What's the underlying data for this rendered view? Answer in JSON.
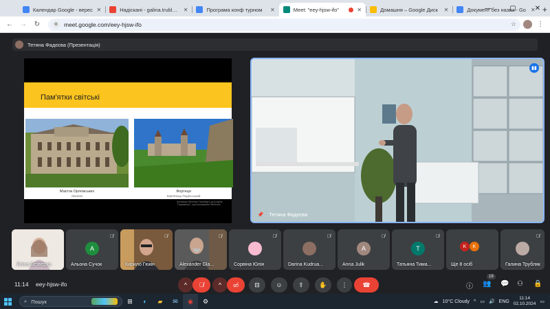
{
  "browser": {
    "tabs": [
      {
        "label": "Календар Google - верес",
        "color": "#4285f4",
        "active": false
      },
      {
        "label": "Надіскані - galina.trublaiev",
        "color": "#ea4335",
        "active": false
      },
      {
        "label": "Програма конф турном",
        "color": "#4285f4",
        "active": false
      },
      {
        "label": "Meet: \"eey-hjsw-ifo\"",
        "color": "#00897b",
        "active": true
      },
      {
        "label": "Домашня – Google Диск",
        "color": "#fbbc04",
        "active": false
      },
      {
        "label": "Документ без назви - Go",
        "color": "#4285f4",
        "active": false
      }
    ],
    "url": "meet.google.com/eey-hjsw-ifo",
    "new_tab": "+",
    "win_min": "—",
    "win_max": "▢",
    "win_close": "✕"
  },
  "meeting": {
    "presenter_header": "Тетяна Фадєєва (Презентація)",
    "slide": {
      "title": "Пам'ятки світські",
      "caption1": "Маєток Орловських",
      "caption1_sub": "Малієві",
      "caption2": "Фортеця",
      "caption2_sub": "Кам'янець-Подільський",
      "footer": "Активація Windows Перейдіть до розділу \"Параметри\", щоб активувати Windows."
    },
    "video_name": "Тетяна Фадєєва",
    "participants": [
      {
        "name": "Яніна Безверха",
        "type": "photo",
        "color": "#d7ccc8"
      },
      {
        "name": "Альона Сучок",
        "type": "letter",
        "letter": "A",
        "color": "#1e8e3e"
      },
      {
        "name": "Кирило Гюкін",
        "type": "photo",
        "color": "#5d4037"
      },
      {
        "name": "Alexander Gla...",
        "type": "photo",
        "color": "#6d6d6d"
      },
      {
        "name": "Сорвіна Юлія",
        "type": "avatar",
        "color": "#f8bbd0"
      },
      {
        "name": "Darina Kudrua...",
        "type": "avatar",
        "color": "#8d6e63"
      },
      {
        "name": "Anna Julik",
        "type": "letter",
        "letter": "A",
        "color": "#a1887f"
      },
      {
        "name": "Татьяна Тима...",
        "type": "letter",
        "letter": "T",
        "color": "#00796b"
      },
      {
        "name": "Ще 8 осіб",
        "type": "more",
        "letters": [
          "K",
          "K"
        ],
        "color": "#c5221f"
      },
      {
        "name": "Галина Трубляк",
        "type": "avatar",
        "color": "#bcaaa4"
      }
    ],
    "time": "11:14",
    "code": "eey-hjsw-ifo",
    "participant_count": "19"
  },
  "taskbar": {
    "search_placeholder": "Пошук",
    "weather": "10°C  Cloudy",
    "lang": "ENG",
    "time": "11:14",
    "date": "02.10.2024"
  }
}
